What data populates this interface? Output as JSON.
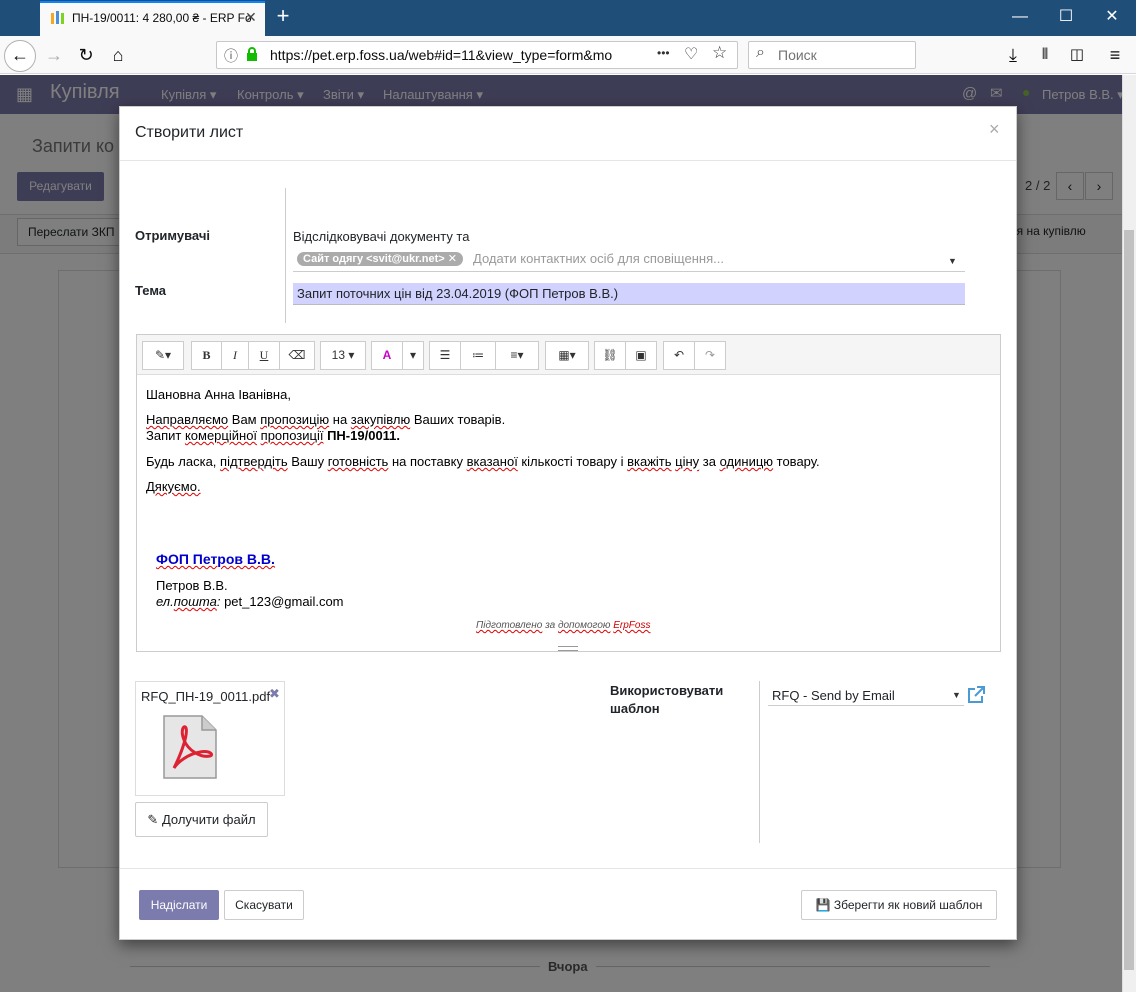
{
  "browser": {
    "tab_title": "ПН-19/0011: 4 280,00 ₴ - ERP Fo",
    "new_tab": "+",
    "url": "https://pet.erp.foss.ua/web#id=11&view_type=form&mo",
    "url_dots": "•••",
    "search_placeholder": "Поиск",
    "win_min": "—",
    "win_max": "☐",
    "win_close": "✕"
  },
  "app": {
    "name": "Купівля",
    "menus": [
      "Купівля ▾",
      "Контроль ▾",
      "Звіти ▾",
      "Налаштування ▾"
    ],
    "user": "Петров В.В. ▾",
    "breadcrumb": "Запити ко",
    "edit_button": "Редагувати",
    "pager": "2 / 2",
    "status_button_left": "Переслати ЗКП",
    "status_button_right": "ня на купівлю",
    "chatter_label": "Вчора"
  },
  "modal": {
    "title": "Створити лист",
    "close": "×",
    "recipients_label": "Отримувачі",
    "recipients_note": "Відслідковувачі документу та",
    "recipient_tag": "Сайт одягу <svit@ukr.net> ✕",
    "recipients_placeholder": "Додати контактних осіб для сповіщення...",
    "subject_label": "Тема",
    "subject_value": "Запит поточних цін від 23.04.2019 (ФОП Петров В.В.)",
    "toolbar": {
      "font_size": "13",
      "bold": "B",
      "italic": "I",
      "underline": "U"
    },
    "body": {
      "greeting": "Шановна Анна Іванівна,",
      "line1_a": "Направляємо",
      "line1_b": " Вам ",
      "line1_c": "пропозицію",
      "line1_d": " на ",
      "line1_e": "закупівлю",
      "line1_f": " Ваших товарів.",
      "line2_a": "Запит ",
      "line2_b": "комерційної",
      "line2_c": " ",
      "line2_d": "пропозиції",
      "line2_e": " ",
      "line2_f": "ПН-19/0011.",
      "line3_a": "Будь ласка, ",
      "line3_b": "підтвердіть",
      "line3_c": " Вашу ",
      "line3_d": "готовність",
      "line3_e": " на поставку ",
      "line3_f": "вказаної",
      "line3_g": " кількості товару і ",
      "line3_h": "вкажіть",
      "line3_i": " ",
      "line3_j": "ціну",
      "line3_k": " за ",
      "line3_l": "одиницю",
      "line3_m": " товару.",
      "thanks": "Дякуємо.",
      "sig_company": "ФОП Петров В.В.",
      "sig_person": "Петров В.В.",
      "sig_email_label_a": "ел.",
      "sig_email_label_b": "пошта",
      "sig_email_label_c": ":",
      "sig_email": " pet_123@gmail.com",
      "powered_a": "Підготовлено",
      "powered_b": " за ",
      "powered_c": "допомогою",
      "powered_d": " ",
      "powered_e": "ErpFoss"
    },
    "attachment": {
      "filename": "RFQ_ПН-19_0011.pdf",
      "remove": "✖",
      "attach_button": "Долучити файл"
    },
    "template_label": "Використовувати шаблон",
    "template_value": "RFQ - Send by Email",
    "send_button": "Надіслати",
    "cancel_button": "Скасувати",
    "save_template_button": "Зберегти як новий шаблон"
  }
}
